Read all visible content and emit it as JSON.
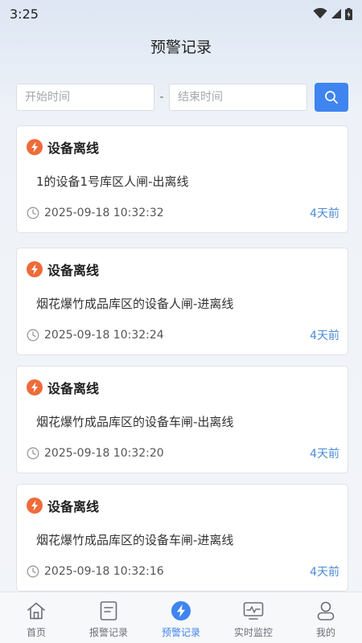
{
  "status_bar": {
    "time": "3:25"
  },
  "header": {
    "title": "预警记录"
  },
  "filter": {
    "start_placeholder": "开始时间",
    "separator": "-",
    "end_placeholder": "结束时间"
  },
  "alerts": [
    {
      "title": "设备离线",
      "description": "1的设备1号库区人闸-出离线",
      "time": "2025-09-18 10:32:32",
      "ago": "4天前"
    },
    {
      "title": "设备离线",
      "description": "烟花爆竹成品库区的设备人闸-进离线",
      "time": "2025-09-18 10:32:24",
      "ago": "4天前"
    },
    {
      "title": "设备离线",
      "description": "烟花爆竹成品库区的设备车闸-出离线",
      "time": "2025-09-18 10:32:20",
      "ago": "4天前"
    },
    {
      "title": "设备离线",
      "description": "烟花爆竹成品库区的设备车闸-进离线",
      "time": "2025-09-18 10:32:16",
      "ago": "4天前"
    }
  ],
  "nav": {
    "items": [
      {
        "label": "首页",
        "icon": "home-icon"
      },
      {
        "label": "报警记录",
        "icon": "document-icon"
      },
      {
        "label": "预警记录",
        "icon": "lightning-icon",
        "active": true
      },
      {
        "label": "实时监控",
        "icon": "monitor-icon"
      },
      {
        "label": "我的",
        "icon": "user-icon"
      }
    ]
  },
  "colors": {
    "accent": "#3f84f0",
    "alert_icon": "#ef6b3a",
    "ago_text": "#4a8bd6"
  }
}
